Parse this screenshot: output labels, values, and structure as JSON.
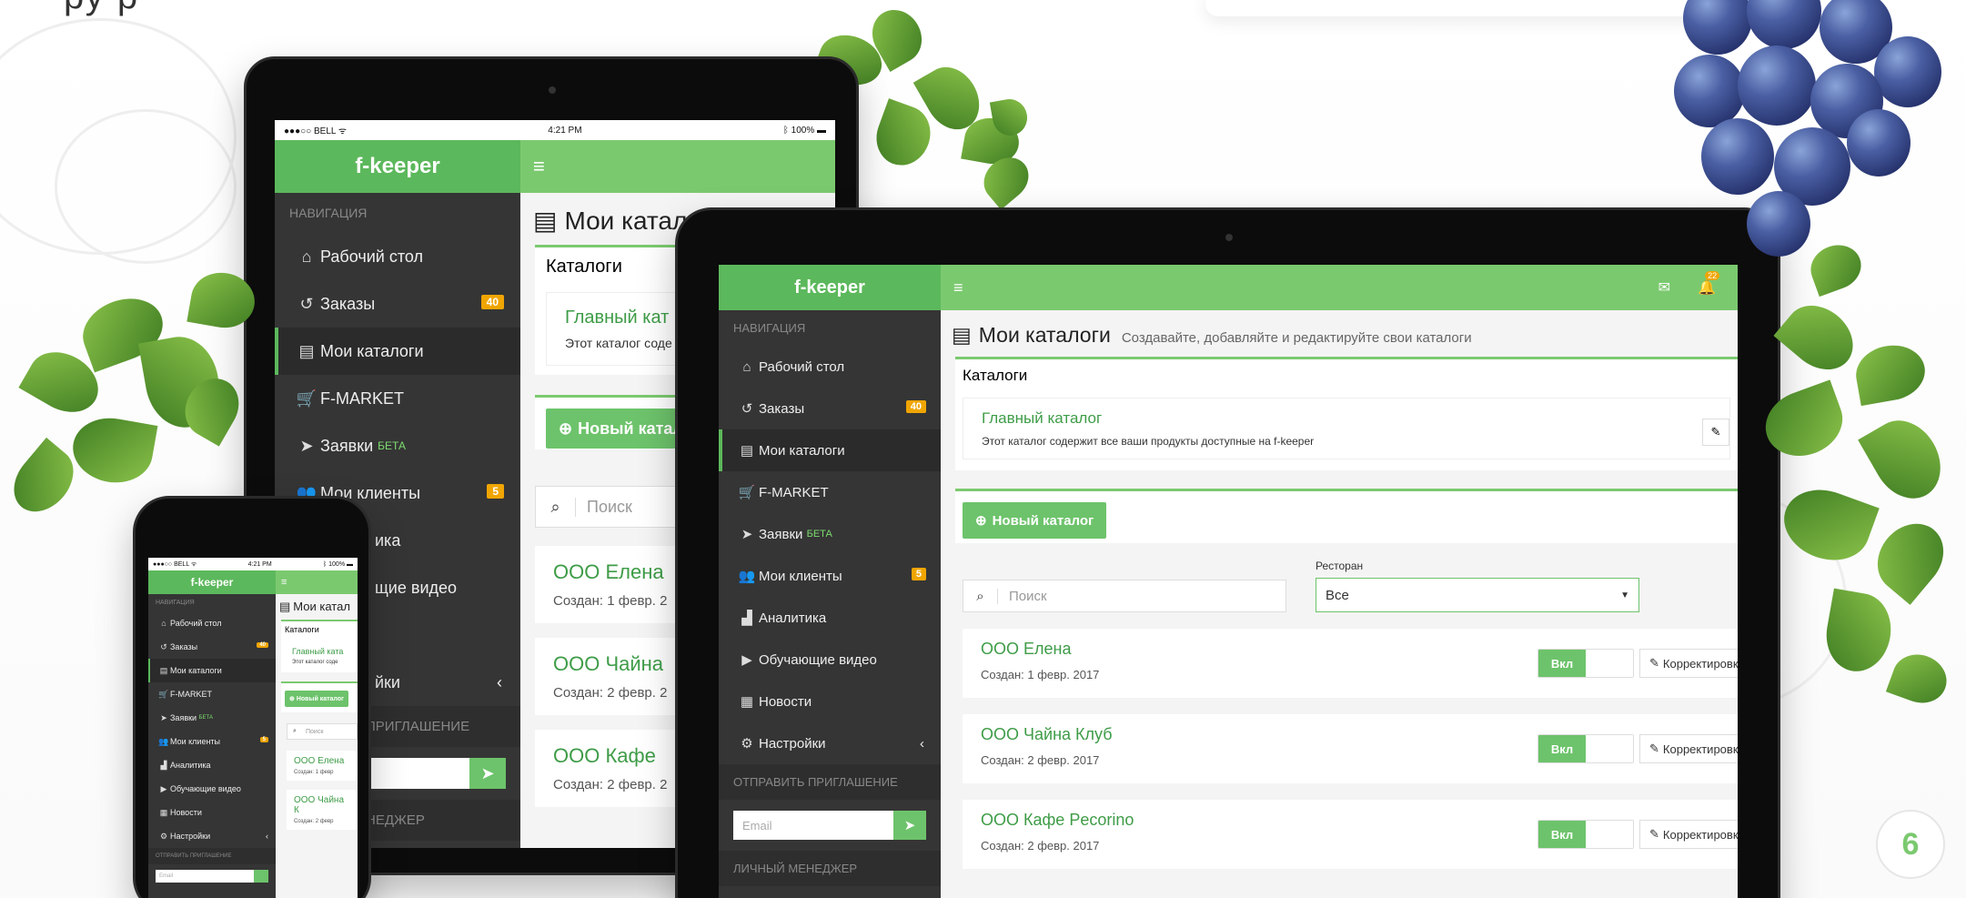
{
  "page_number": "6",
  "heading_fragment": "ру                        р",
  "status_bar": {
    "carrier": "●●●○○ BELL ᯤ",
    "time": "4:21 PM",
    "battery": "ᛒ 100% ▬"
  },
  "app": {
    "logo": "f-keeper",
    "menu_icon": "≡",
    "notification_count": "22",
    "nav_section": "НАВИГАЦИЯ",
    "nav": [
      {
        "icon": "home-icon",
        "glyph": "⌂",
        "label": "Рабочий стол"
      },
      {
        "icon": "history-icon",
        "glyph": "↺",
        "label": "Заказы",
        "badge": "40"
      },
      {
        "icon": "list-icon",
        "glyph": "▤",
        "label": "Мои каталоги",
        "active": true
      },
      {
        "icon": "cart-icon",
        "glyph": "🛒",
        "label": "F-MARKET"
      },
      {
        "icon": "send-icon",
        "glyph": "➤",
        "label": "Заявки",
        "sup": "БЕТА"
      },
      {
        "icon": "users-icon",
        "glyph": "👥",
        "label": "Мои клиенты",
        "badge": "5"
      },
      {
        "icon": "chart-icon",
        "glyph": "▟",
        "label": "Аналитика"
      },
      {
        "icon": "play-icon",
        "glyph": "▶",
        "label": "Обучающие видео"
      },
      {
        "icon": "news-icon",
        "glyph": "▦",
        "label": "Новости"
      },
      {
        "icon": "gears-icon",
        "glyph": "⚙",
        "label": "Настройки",
        "chevron": "‹"
      }
    ],
    "invite_section": "ОТПРАВИТЬ ПРИГЛАШЕНИЕ",
    "email_placeholder": "Email",
    "manager_section": "ЛИЧНЫЙ МЕНЕДЖЕР",
    "page_title": "Мои каталоги",
    "page_subtitle": "Создавайте, добавляйте и редактируйте свои каталоги",
    "catalogs_header": "Каталоги",
    "main_catalog": {
      "title": "Главный каталог",
      "desc": "Этот каталог содержит все ваши продукты доступные на f-keeper"
    },
    "new_catalog_button": "Новый каталог",
    "search_placeholder": "Поиск",
    "restaurant_label": "Ресторан",
    "restaurant_value": "Все",
    "toggle_on": "Вкл",
    "edit_label": "Корректировка ц",
    "suppliers": [
      {
        "name": "ООО Елена",
        "created": "Создан: 1 февр. 2017"
      },
      {
        "name": "ООО Чайна Клуб",
        "created": "Создан: 2 февр. 2017"
      },
      {
        "name": "ООО Кафе Pecorino",
        "created": "Создан: 2 февр. 2017"
      }
    ]
  },
  "tablet_fragments": {
    "title": "Мои катал",
    "main_catalog": "Главный кат",
    "main_desc": "Этот каталог соде",
    "new_catalog": "Новый катал",
    "search": "Поиск",
    "s1": "ООО Елена",
    "s1_date": "Создан: 1 февр. 2",
    "s2": "ООО Чайна",
    "s2_date": "Создан: 2 февр. 2",
    "s3": "ООО Кафе",
    "s3_date": "Создан: 2 февр. 2",
    "nav_clients": "Мои клиенты",
    "nav_analytics": "ика",
    "nav_video": "щие видео",
    "nav_settings": "йки",
    "invite": "ПРИГЛАШЕНИЕ",
    "manager": "НЕДЖЕР"
  },
  "phone_fragments": {
    "title": "Мои катал",
    "catalogs": "Каталоги",
    "main_catalog": "Главный ката",
    "main_desc": "Этот каталог соде",
    "new_catalog": "Новый каталог",
    "search": "Поиск",
    "s1": "ООО Елена",
    "s1_date": "Создан: 1 февр",
    "s2": "ООО Чайна К",
    "s2_date": "Создан: 2 февр"
  },
  "colors": {
    "accent": "#7bc96f",
    "sidebar": "#353535",
    "badge": "#f0a500",
    "link": "#3e9c47"
  }
}
